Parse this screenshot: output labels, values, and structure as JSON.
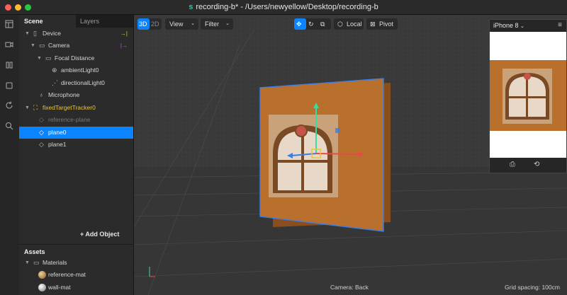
{
  "window": {
    "title": "recording-b* - /Users/newyellow/Desktop/recording-b"
  },
  "rail": {
    "icons": [
      "layout-icon",
      "video-icon",
      "bars-icon",
      "square-icon",
      "refresh-icon",
      "search-icon"
    ]
  },
  "scene_panel": {
    "tabs": {
      "scene": "Scene",
      "layers": "Layers"
    },
    "tree": [
      {
        "label": "Device",
        "icon": "phone-icon",
        "indent": 0,
        "expanded": true
      },
      {
        "label": "Camera",
        "icon": "camera-icon",
        "indent": 1,
        "expanded": true
      },
      {
        "label": "Focal Distance",
        "icon": "focal-icon",
        "indent": 2,
        "expanded": true
      },
      {
        "label": "ambientLight0",
        "icon": "globe-icon",
        "indent": 3
      },
      {
        "label": "directionalLight0",
        "icon": "light-icon",
        "indent": 3
      },
      {
        "label": "Microphone",
        "icon": "mic-icon",
        "indent": 1
      },
      {
        "label": "fixedTargetTracker0",
        "icon": "tracker-icon",
        "indent": 0,
        "expanded": true
      },
      {
        "label": "reference-plane",
        "icon": "plane-icon",
        "indent": 1
      },
      {
        "label": "plane0",
        "icon": "plane-icon",
        "indent": 1,
        "selected": true
      },
      {
        "label": "plane1",
        "icon": "plane-icon",
        "indent": 1
      }
    ],
    "add_object": "+ Add Object"
  },
  "assets": {
    "header": "Assets",
    "folder": "Materials",
    "items": [
      {
        "label": "reference-mat"
      },
      {
        "label": "wall-mat"
      }
    ]
  },
  "viewport": {
    "mode_3d": "3D",
    "mode_2d": "2D",
    "view": "View",
    "filter": "Filter",
    "local": "Local",
    "pivot": "Pivot",
    "camera_status": "Camera: Back",
    "grid_status": "Grid spacing: 100cm"
  },
  "preview": {
    "device": "iPhone 8"
  },
  "colors": {
    "accent": "#0a84ff",
    "tracker": "#e8c53a",
    "plane_wood": "#b8702c",
    "gizmo_x": "#e84a4a",
    "gizmo_y": "#3adba0",
    "gizmo_z": "#3a7ee8"
  }
}
